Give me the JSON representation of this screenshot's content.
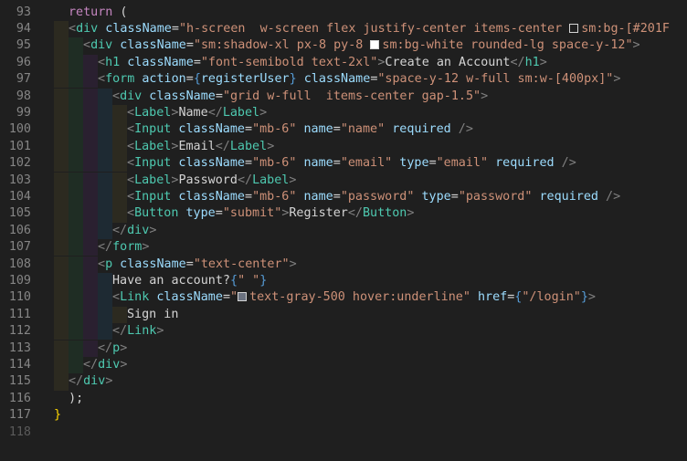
{
  "editor": {
    "lines": [
      {
        "n": "93",
        "indent": 0,
        "tokens": [
          {
            "t": "kw",
            "v": "return"
          },
          {
            "t": "paren",
            "v": " ("
          }
        ]
      },
      {
        "n": "94",
        "indent": 1,
        "tokens": [
          {
            "t": "punc",
            "v": "<"
          },
          {
            "t": "tag",
            "v": "div"
          },
          {
            "t": "attr",
            "v": " className"
          },
          {
            "t": "txt",
            "v": "="
          },
          {
            "t": "str",
            "v": "\"h-screen  w-screen flex justify-center items-center "
          },
          {
            "t": "swatch",
            "v": "#ffffff"
          },
          {
            "t": "str",
            "v": "sm:bg-[#201F"
          }
        ]
      },
      {
        "n": "95",
        "indent": 2,
        "tokens": [
          {
            "t": "punc",
            "v": "<"
          },
          {
            "t": "tag",
            "v": "div"
          },
          {
            "t": "attr",
            "v": " className"
          },
          {
            "t": "txt",
            "v": "="
          },
          {
            "t": "str",
            "v": "\"sm:shadow-xl px-8 py-8 "
          },
          {
            "t": "swatchfill",
            "v": "#ffffff"
          },
          {
            "t": "str",
            "v": "sm:bg-white rounded-lg space-y-12\""
          },
          {
            "t": "punc",
            "v": ">"
          }
        ]
      },
      {
        "n": "96",
        "indent": 3,
        "tokens": [
          {
            "t": "punc",
            "v": "<"
          },
          {
            "t": "tag",
            "v": "h1"
          },
          {
            "t": "attr",
            "v": " className"
          },
          {
            "t": "txt",
            "v": "="
          },
          {
            "t": "str",
            "v": "\"font-semibold text-2xl\""
          },
          {
            "t": "punc",
            "v": ">"
          },
          {
            "t": "txt",
            "v": "Create an Account"
          },
          {
            "t": "punc",
            "v": "</"
          },
          {
            "t": "tag",
            "v": "h1"
          },
          {
            "t": "punc",
            "v": ">"
          }
        ]
      },
      {
        "n": "97",
        "indent": 3,
        "tokens": [
          {
            "t": "punc",
            "v": "<"
          },
          {
            "t": "tag",
            "v": "form"
          },
          {
            "t": "attr",
            "v": " action"
          },
          {
            "t": "txt",
            "v": "="
          },
          {
            "t": "brace",
            "v": "{"
          },
          {
            "t": "attr",
            "v": "registerUser"
          },
          {
            "t": "brace",
            "v": "}"
          },
          {
            "t": "attr",
            "v": " className"
          },
          {
            "t": "txt",
            "v": "="
          },
          {
            "t": "str",
            "v": "\"space-y-12 w-full sm:w-[400px]\""
          },
          {
            "t": "punc",
            "v": ">"
          }
        ]
      },
      {
        "n": "98",
        "indent": 4,
        "tokens": [
          {
            "t": "punc",
            "v": "<"
          },
          {
            "t": "tag",
            "v": "div"
          },
          {
            "t": "attr",
            "v": " className"
          },
          {
            "t": "txt",
            "v": "="
          },
          {
            "t": "str",
            "v": "\"grid w-full  items-center gap-1.5\""
          },
          {
            "t": "punc",
            "v": ">"
          }
        ]
      },
      {
        "n": "99",
        "indent": 5,
        "tokens": [
          {
            "t": "punc",
            "v": "<"
          },
          {
            "t": "tag",
            "v": "Label"
          },
          {
            "t": "punc",
            "v": ">"
          },
          {
            "t": "txt",
            "v": "Name"
          },
          {
            "t": "punc",
            "v": "</"
          },
          {
            "t": "tag",
            "v": "Label"
          },
          {
            "t": "punc",
            "v": ">"
          }
        ]
      },
      {
        "n": "100",
        "indent": 5,
        "tokens": [
          {
            "t": "punc",
            "v": "<"
          },
          {
            "t": "tag",
            "v": "Input"
          },
          {
            "t": "attr",
            "v": " className"
          },
          {
            "t": "txt",
            "v": "="
          },
          {
            "t": "str",
            "v": "\"mb-6\""
          },
          {
            "t": "attr",
            "v": " name"
          },
          {
            "t": "txt",
            "v": "="
          },
          {
            "t": "str",
            "v": "\"name\""
          },
          {
            "t": "attr",
            "v": " required"
          },
          {
            "t": "punc",
            "v": " />"
          }
        ]
      },
      {
        "n": "101",
        "indent": 5,
        "tokens": [
          {
            "t": "punc",
            "v": "<"
          },
          {
            "t": "tag",
            "v": "Label"
          },
          {
            "t": "punc",
            "v": ">"
          },
          {
            "t": "txt",
            "v": "Email"
          },
          {
            "t": "punc",
            "v": "</"
          },
          {
            "t": "tag",
            "v": "Label"
          },
          {
            "t": "punc",
            "v": ">"
          }
        ]
      },
      {
        "n": "102",
        "indent": 5,
        "tokens": [
          {
            "t": "punc",
            "v": "<"
          },
          {
            "t": "tag",
            "v": "Input"
          },
          {
            "t": "attr",
            "v": " className"
          },
          {
            "t": "txt",
            "v": "="
          },
          {
            "t": "str",
            "v": "\"mb-6\""
          },
          {
            "t": "attr",
            "v": " name"
          },
          {
            "t": "txt",
            "v": "="
          },
          {
            "t": "str",
            "v": "\"email\""
          },
          {
            "t": "attr",
            "v": " type"
          },
          {
            "t": "txt",
            "v": "="
          },
          {
            "t": "str",
            "v": "\"email\""
          },
          {
            "t": "attr",
            "v": " required"
          },
          {
            "t": "punc",
            "v": " />"
          }
        ]
      },
      {
        "n": "103",
        "indent": 5,
        "tokens": [
          {
            "t": "punc",
            "v": "<"
          },
          {
            "t": "tag",
            "v": "Label"
          },
          {
            "t": "punc",
            "v": ">"
          },
          {
            "t": "txt",
            "v": "Password"
          },
          {
            "t": "punc",
            "v": "</"
          },
          {
            "t": "tag",
            "v": "Label"
          },
          {
            "t": "punc",
            "v": ">"
          }
        ]
      },
      {
        "n": "104",
        "indent": 5,
        "tokens": [
          {
            "t": "punc",
            "v": "<"
          },
          {
            "t": "tag",
            "v": "Input"
          },
          {
            "t": "attr",
            "v": " className"
          },
          {
            "t": "txt",
            "v": "="
          },
          {
            "t": "str",
            "v": "\"mb-6\""
          },
          {
            "t": "attr",
            "v": " name"
          },
          {
            "t": "txt",
            "v": "="
          },
          {
            "t": "str",
            "v": "\"password\""
          },
          {
            "t": "attr",
            "v": " type"
          },
          {
            "t": "txt",
            "v": "="
          },
          {
            "t": "str",
            "v": "\"password\""
          },
          {
            "t": "attr",
            "v": " required"
          },
          {
            "t": "punc",
            "v": " />"
          }
        ]
      },
      {
        "n": "105",
        "indent": 5,
        "tokens": [
          {
            "t": "punc",
            "v": "<"
          },
          {
            "t": "tag",
            "v": "Button"
          },
          {
            "t": "attr",
            "v": " type"
          },
          {
            "t": "txt",
            "v": "="
          },
          {
            "t": "str",
            "v": "\"submit\""
          },
          {
            "t": "punc",
            "v": ">"
          },
          {
            "t": "txt",
            "v": "Register"
          },
          {
            "t": "punc",
            "v": "</"
          },
          {
            "t": "tag",
            "v": "Button"
          },
          {
            "t": "punc",
            "v": ">"
          }
        ]
      },
      {
        "n": "106",
        "indent": 4,
        "tokens": [
          {
            "t": "punc",
            "v": "</"
          },
          {
            "t": "tag",
            "v": "div"
          },
          {
            "t": "punc",
            "v": ">"
          }
        ]
      },
      {
        "n": "107",
        "indent": 3,
        "tokens": [
          {
            "t": "punc",
            "v": "</"
          },
          {
            "t": "tag",
            "v": "form"
          },
          {
            "t": "punc",
            "v": ">"
          }
        ]
      },
      {
        "n": "108",
        "indent": 3,
        "tokens": [
          {
            "t": "punc",
            "v": "<"
          },
          {
            "t": "tag",
            "v": "p"
          },
          {
            "t": "attr",
            "v": " className"
          },
          {
            "t": "txt",
            "v": "="
          },
          {
            "t": "str",
            "v": "\"text-center\""
          },
          {
            "t": "punc",
            "v": ">"
          }
        ]
      },
      {
        "n": "109",
        "indent": 4,
        "tokens": [
          {
            "t": "txt",
            "v": "Have an account?"
          },
          {
            "t": "brace",
            "v": "{"
          },
          {
            "t": "str",
            "v": "\" \""
          },
          {
            "t": "brace",
            "v": "}"
          }
        ]
      },
      {
        "n": "110",
        "indent": 4,
        "tokens": [
          {
            "t": "punc",
            "v": "<"
          },
          {
            "t": "tag",
            "v": "Link"
          },
          {
            "t": "attr",
            "v": " className"
          },
          {
            "t": "txt",
            "v": "="
          },
          {
            "t": "str",
            "v": "\""
          },
          {
            "t": "swatchfill",
            "v": "#6b7280"
          },
          {
            "t": "str",
            "v": "text-gray-500 hover:underline\""
          },
          {
            "t": "attr",
            "v": " href"
          },
          {
            "t": "txt",
            "v": "="
          },
          {
            "t": "brace",
            "v": "{"
          },
          {
            "t": "str",
            "v": "\"/login\""
          },
          {
            "t": "brace",
            "v": "}"
          },
          {
            "t": "punc",
            "v": ">"
          }
        ]
      },
      {
        "n": "111",
        "indent": 5,
        "tokens": [
          {
            "t": "txt",
            "v": "Sign in"
          }
        ]
      },
      {
        "n": "112",
        "indent": 4,
        "tokens": [
          {
            "t": "punc",
            "v": "</"
          },
          {
            "t": "tag",
            "v": "Link"
          },
          {
            "t": "punc",
            "v": ">"
          }
        ]
      },
      {
        "n": "113",
        "indent": 3,
        "tokens": [
          {
            "t": "punc",
            "v": "</"
          },
          {
            "t": "tag",
            "v": "p"
          },
          {
            "t": "punc",
            "v": ">"
          }
        ]
      },
      {
        "n": "114",
        "indent": 2,
        "tokens": [
          {
            "t": "punc",
            "v": "</"
          },
          {
            "t": "tag",
            "v": "div"
          },
          {
            "t": "punc",
            "v": ">"
          }
        ]
      },
      {
        "n": "115",
        "indent": 1,
        "tokens": [
          {
            "t": "punc",
            "v": "</"
          },
          {
            "t": "tag",
            "v": "div"
          },
          {
            "t": "punc",
            "v": ">"
          }
        ]
      },
      {
        "n": "116",
        "indent": 0,
        "tokens": [
          {
            "t": "paren",
            "v": "  );"
          }
        ]
      },
      {
        "n": "117",
        "indent": 0,
        "tokens": [
          {
            "t": "yellow",
            "v": "}"
          }
        ]
      },
      {
        "n": "118",
        "indent": 0,
        "dim": true,
        "tokens": []
      }
    ],
    "guide_colors": [
      "#2c2a20",
      "#1f2d24",
      "#2a2030",
      "#1e2a33",
      "#2c2a20",
      "#1f2d24"
    ]
  }
}
